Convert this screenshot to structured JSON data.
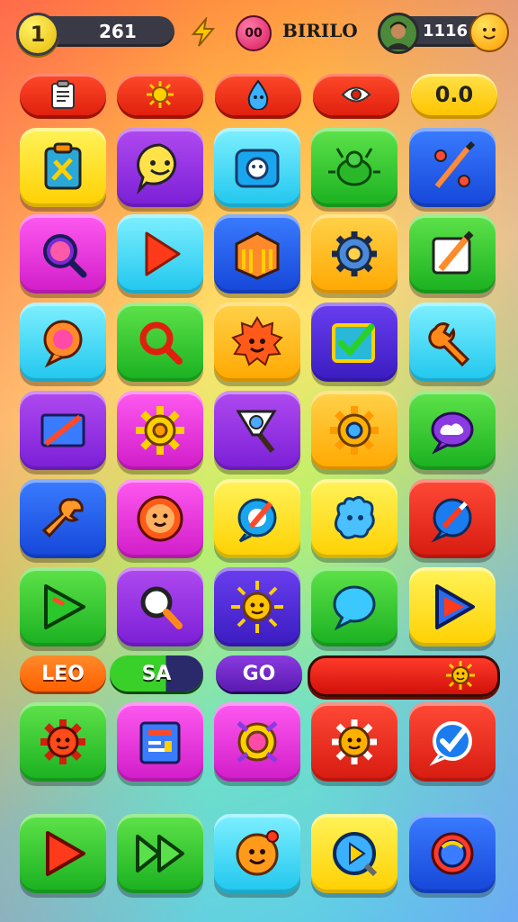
{
  "hud": {
    "level_badge": "1",
    "coins": "261",
    "gem_label": "00",
    "player_name": "BIRILO",
    "score": "1116"
  },
  "toolbar": {
    "badge": "0.0"
  },
  "mid_bar": {
    "left_label": "LEO",
    "green_label": "SA",
    "purple_label": "GO"
  },
  "colors": {
    "accent_red": "#e0200e",
    "accent_yellow": "#ffc400"
  },
  "icons": [
    [
      "clipboard-icon",
      "smiley-chat-icon",
      "camera-face-icon",
      "bug-icon",
      "percent-pencil-icon"
    ],
    [
      "magnifier-icon",
      "play-icon",
      "box-icon",
      "gear-icon",
      "edit-icon"
    ],
    [
      "chat-bubble-icon",
      "search-icon",
      "sun-face-icon",
      "checklist-icon",
      "wrench-icon"
    ],
    [
      "ruler-icon",
      "gear-icon",
      "brush-icon",
      "gear-icon",
      "cloud-chat-icon"
    ],
    [
      "wrench-icon",
      "face-icon",
      "pencil-target-icon",
      "paw-icon",
      "wrench-circle-icon"
    ],
    [
      "play-icon",
      "magnifier-icon",
      "sun-icon",
      "chat-bubble-icon",
      "play-icon"
    ],
    [
      "gear-face-icon",
      "news-icon",
      "target-icon",
      "gear-face-icon",
      "check-icon"
    ],
    [
      "play-icon",
      "fast-forward-icon",
      "face-icon",
      "play-circle-icon",
      "headset-icon"
    ]
  ]
}
